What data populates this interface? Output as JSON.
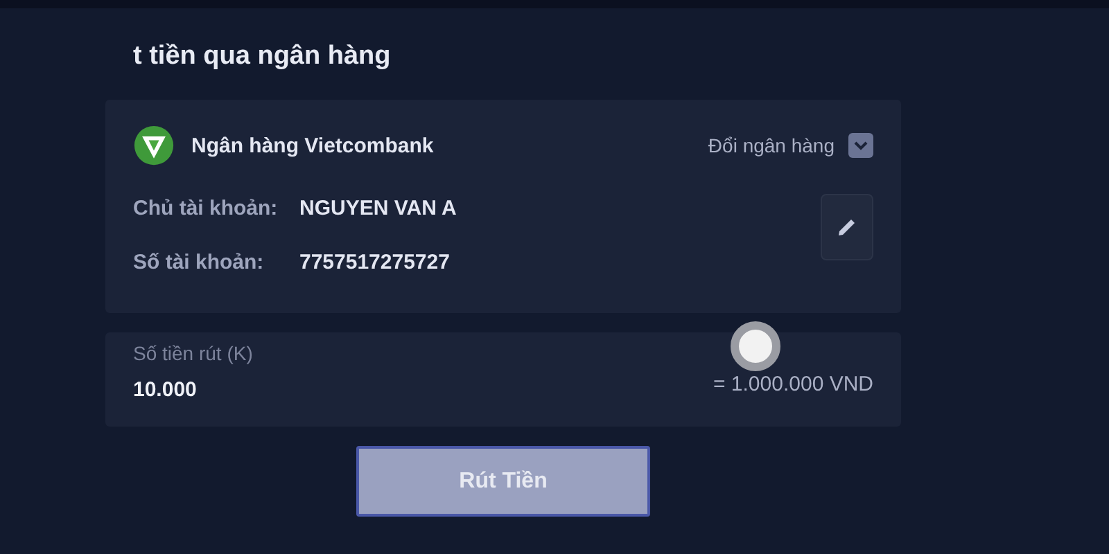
{
  "title": "t tiền qua ngân hàng",
  "bank": {
    "name": "Ngân hàng Vietcombank",
    "change_label": "Đổi ngân hàng",
    "fields": [
      {
        "label": "Chủ tài khoản:",
        "value": "NGUYEN VAN A"
      },
      {
        "label": "Số tài khoản:",
        "value": "7757517275727"
      }
    ]
  },
  "amount": {
    "label": "Số tiền rút (K)",
    "value": "10.000",
    "converted": "= 1.000.000 VND"
  },
  "submit": {
    "label": "Rút Tiền",
    "disabled": true
  }
}
